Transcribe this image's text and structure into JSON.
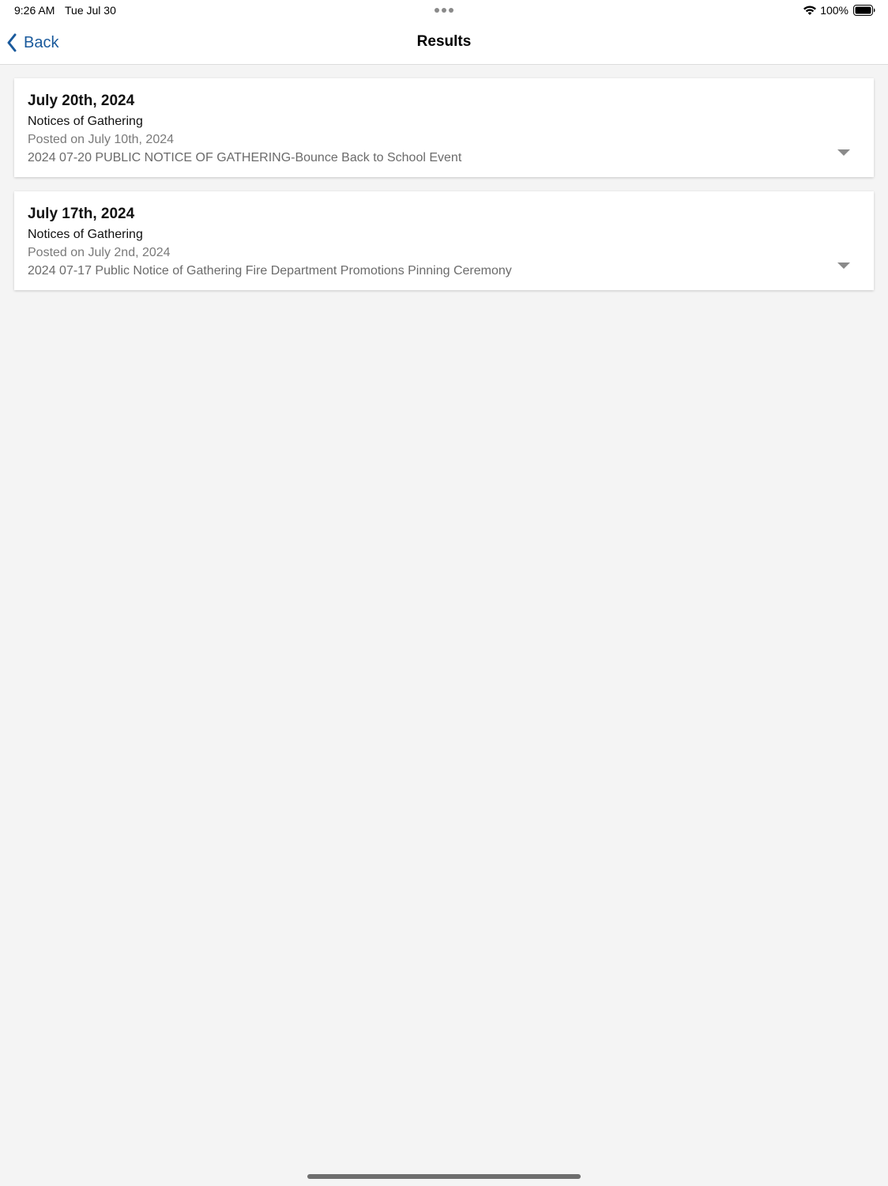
{
  "status_bar": {
    "time": "9:26 AM",
    "date": "Tue Jul 30",
    "battery": "100%"
  },
  "nav": {
    "back_label": "Back",
    "title": "Results"
  },
  "results": [
    {
      "date": "July 20th, 2024",
      "category": "Notices of Gathering",
      "posted": "Posted on July 10th, 2024",
      "title": "2024 07-20 PUBLIC NOTICE OF GATHERING-Bounce Back to School Event"
    },
    {
      "date": "July 17th, 2024",
      "category": "Notices of Gathering",
      "posted": "Posted on July 2nd, 2024",
      "title": "2024 07-17 Public Notice of Gathering Fire Department Promotions Pinning Ceremony"
    }
  ],
  "colors": {
    "accent": "#1a5a9c",
    "background": "#f4f4f4",
    "card": "#ffffff",
    "muted_text": "#7a7a7a"
  },
  "icons": {
    "back": "chevron-left-icon",
    "expand": "caret-down-icon",
    "wifi": "wifi-icon",
    "battery": "battery-icon",
    "multitask": "multitask-dots-icon"
  }
}
